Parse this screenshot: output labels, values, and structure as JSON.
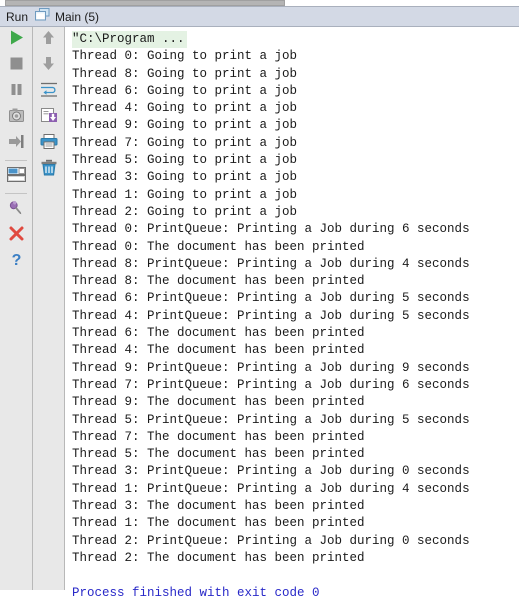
{
  "window": {
    "title_bar": {
      "run_label": "Run",
      "tab_icon": "window-restore-icon",
      "tab_label": "Main (5)"
    }
  },
  "colors": {
    "tabbar_bg": "#d3d9e5",
    "toolbar_bg": "#e8e8e8",
    "console_bg": "#ffffff",
    "console_text": "#1a1a1a",
    "exit_text": "#2828c8",
    "header_highlight": "#e4f2e3",
    "play_green": "#4caf50",
    "stop_gray": "#8c8c8c",
    "icon_blue": "#3b93c9",
    "pin_purple": "#9a6fb5",
    "close_red": "#e04a3f",
    "help_blue": "#3b7fc4"
  },
  "run_toolbar": {
    "buttons": [
      {
        "name": "rerun-button",
        "icon": "play-icon",
        "tooltip": "Rerun"
      },
      {
        "name": "stop-button",
        "icon": "stop-icon",
        "tooltip": "Stop"
      },
      {
        "name": "pause-button",
        "icon": "pause-icon",
        "tooltip": "Pause Output"
      },
      {
        "name": "dump-threads-button",
        "icon": "camera-icon",
        "tooltip": "Dump Threads"
      },
      {
        "name": "step-into-button",
        "icon": "step-into-icon",
        "tooltip": "Step Into"
      },
      {
        "name": "layout-button",
        "icon": "layout-icon",
        "tooltip": "Layout"
      },
      {
        "name": "pin-tab-button",
        "icon": "pin-icon",
        "tooltip": "Pin Tab"
      },
      {
        "name": "close-button",
        "icon": "close-x-icon",
        "tooltip": "Close"
      },
      {
        "name": "help-button",
        "icon": "question-mark-icon",
        "tooltip": "Help"
      }
    ]
  },
  "console_toolbar": {
    "buttons": [
      {
        "name": "up-the-stack-button",
        "icon": "arrow-up-icon",
        "tooltip": "Up the Stack Trace"
      },
      {
        "name": "down-the-stack-button",
        "icon": "arrow-down-icon",
        "tooltip": "Down the Stack Trace"
      },
      {
        "name": "soft-wrap-button",
        "icon": "soft-wrap-icon",
        "tooltip": "Use Soft Wraps"
      },
      {
        "name": "export-button",
        "icon": "export-icon",
        "tooltip": "Export to Text File"
      },
      {
        "name": "print-button",
        "icon": "printer-icon",
        "tooltip": "Print"
      },
      {
        "name": "clear-all-button",
        "icon": "trash-icon",
        "tooltip": "Clear All"
      }
    ]
  },
  "console": {
    "lines": [
      {
        "text": "\"C:\\Program ...",
        "style": "header"
      },
      {
        "text": "Thread 0: Going to print a job",
        "style": "normal"
      },
      {
        "text": "Thread 8: Going to print a job",
        "style": "normal"
      },
      {
        "text": "Thread 6: Going to print a job",
        "style": "normal"
      },
      {
        "text": "Thread 4: Going to print a job",
        "style": "normal"
      },
      {
        "text": "Thread 9: Going to print a job",
        "style": "normal"
      },
      {
        "text": "Thread 7: Going to print a job",
        "style": "normal"
      },
      {
        "text": "Thread 5: Going to print a job",
        "style": "normal"
      },
      {
        "text": "Thread 3: Going to print a job",
        "style": "normal"
      },
      {
        "text": "Thread 1: Going to print a job",
        "style": "normal"
      },
      {
        "text": "Thread 2: Going to print a job",
        "style": "normal"
      },
      {
        "text": "Thread 0: PrintQueue: Printing a Job during 6 seconds",
        "style": "normal"
      },
      {
        "text": "Thread 0: The document has been printed",
        "style": "normal"
      },
      {
        "text": "Thread 8: PrintQueue: Printing a Job during 4 seconds",
        "style": "normal"
      },
      {
        "text": "Thread 8: The document has been printed",
        "style": "normal"
      },
      {
        "text": "Thread 6: PrintQueue: Printing a Job during 5 seconds",
        "style": "normal"
      },
      {
        "text": "Thread 4: PrintQueue: Printing a Job during 5 seconds",
        "style": "normal"
      },
      {
        "text": "Thread 6: The document has been printed",
        "style": "normal"
      },
      {
        "text": "Thread 4: The document has been printed",
        "style": "normal"
      },
      {
        "text": "Thread 9: PrintQueue: Printing a Job during 9 seconds",
        "style": "normal"
      },
      {
        "text": "Thread 7: PrintQueue: Printing a Job during 6 seconds",
        "style": "normal"
      },
      {
        "text": "Thread 9: The document has been printed",
        "style": "normal"
      },
      {
        "text": "Thread 5: PrintQueue: Printing a Job during 5 seconds",
        "style": "normal"
      },
      {
        "text": "Thread 7: The document has been printed",
        "style": "normal"
      },
      {
        "text": "Thread 5: The document has been printed",
        "style": "normal"
      },
      {
        "text": "Thread 3: PrintQueue: Printing a Job during 0 seconds",
        "style": "normal"
      },
      {
        "text": "Thread 1: PrintQueue: Printing a Job during 4 seconds",
        "style": "normal"
      },
      {
        "text": "Thread 3: The document has been printed",
        "style": "normal"
      },
      {
        "text": "Thread 1: The document has been printed",
        "style": "normal"
      },
      {
        "text": "Thread 2: PrintQueue: Printing a Job during 0 seconds",
        "style": "normal"
      },
      {
        "text": "Thread 2: The document has been printed",
        "style": "normal"
      },
      {
        "text": " ",
        "style": "blank"
      },
      {
        "text": "Process finished with exit code 0",
        "style": "exit"
      }
    ]
  },
  "scrollbar": {
    "name": "horizontal-scrollbar",
    "thumb_left_pct": 1,
    "thumb_width_pct": 54
  }
}
